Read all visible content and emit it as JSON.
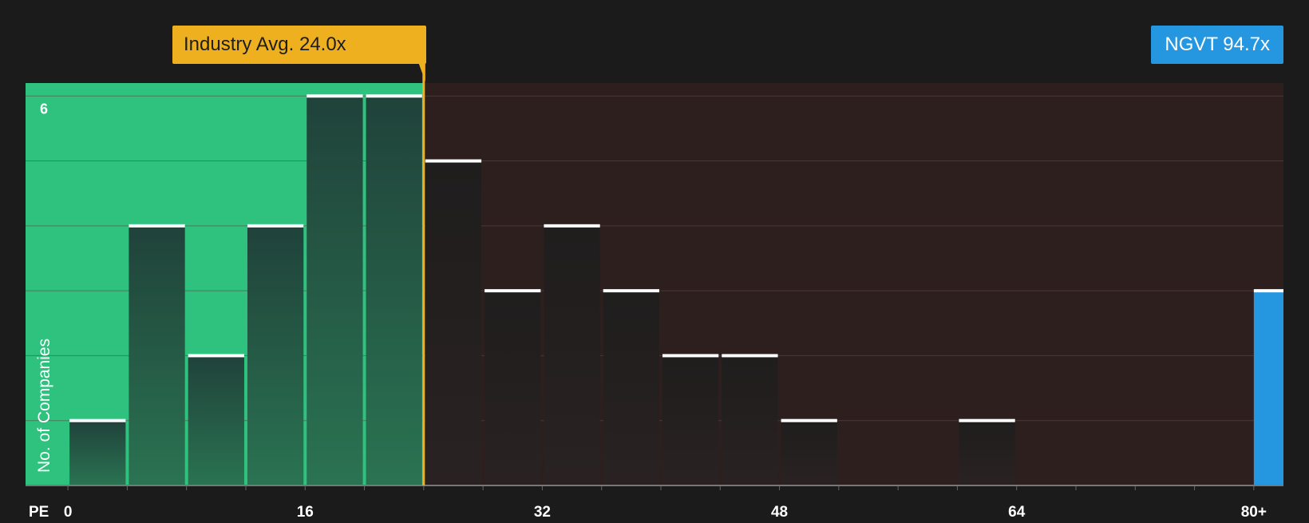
{
  "chart_data": {
    "type": "bar",
    "xlabel": "PE",
    "ylabel": "No. of Companies",
    "x_ticks": [
      {
        "value": 0,
        "label": "0"
      },
      {
        "value": 16,
        "label": "16"
      },
      {
        "value": 32,
        "label": "32"
      },
      {
        "value": 48,
        "label": "48"
      },
      {
        "value": 64,
        "label": "64"
      },
      {
        "value": 80,
        "label": "80+"
      }
    ],
    "y_ticks": [
      {
        "value": 6,
        "label": "6"
      }
    ],
    "xlim": [
      -2.86,
      82
    ],
    "ylim": [
      0,
      6.2
    ],
    "bin_width": 4,
    "bars": [
      {
        "x0": 0,
        "x1": 4,
        "count": 1
      },
      {
        "x0": 4,
        "x1": 8,
        "count": 4
      },
      {
        "x0": 8,
        "x1": 12,
        "count": 2
      },
      {
        "x0": 12,
        "x1": 16,
        "count": 4
      },
      {
        "x0": 16,
        "x1": 20,
        "count": 6
      },
      {
        "x0": 20,
        "x1": 24,
        "count": 6
      },
      {
        "x0": 24,
        "x1": 28,
        "count": 5
      },
      {
        "x0": 28,
        "x1": 32,
        "count": 3
      },
      {
        "x0": 32,
        "x1": 36,
        "count": 4
      },
      {
        "x0": 36,
        "x1": 40,
        "count": 3
      },
      {
        "x0": 40,
        "x1": 44,
        "count": 2
      },
      {
        "x0": 44,
        "x1": 48,
        "count": 2
      },
      {
        "x0": 48,
        "x1": 52,
        "count": 1
      },
      {
        "x0": 52,
        "x1": 56,
        "count": 0
      },
      {
        "x0": 56,
        "x1": 60,
        "count": 0
      },
      {
        "x0": 60,
        "x1": 64,
        "count": 1
      },
      {
        "x0": 64,
        "x1": 68,
        "count": 0
      },
      {
        "x0": 68,
        "x1": 72,
        "count": 0
      },
      {
        "x0": 72,
        "x1": 76,
        "count": 0
      },
      {
        "x0": 76,
        "x1": 80,
        "count": 0
      },
      {
        "x0": 80,
        "x1": 82,
        "count": 3,
        "highlight": true
      }
    ],
    "industry_avg": {
      "value": 24.0,
      "label": "Industry Avg. 24.0x"
    },
    "company": {
      "name": "NGVT",
      "value": 94.7,
      "label": "NGVT 94.7x"
    },
    "grid": true,
    "colors": {
      "background": "#1b1b1b",
      "below_avg_region": "#2ec27e",
      "above_avg_region": "#2e1f1f",
      "bar_in_green": "#244a3a",
      "bar_in_red": "#231f1f",
      "company_bar": "#2596e0",
      "industry_marker": "#efb020",
      "bar_cap": "#ffffff",
      "text": "#ffffff",
      "grid_line": "#5a4a4a"
    }
  }
}
